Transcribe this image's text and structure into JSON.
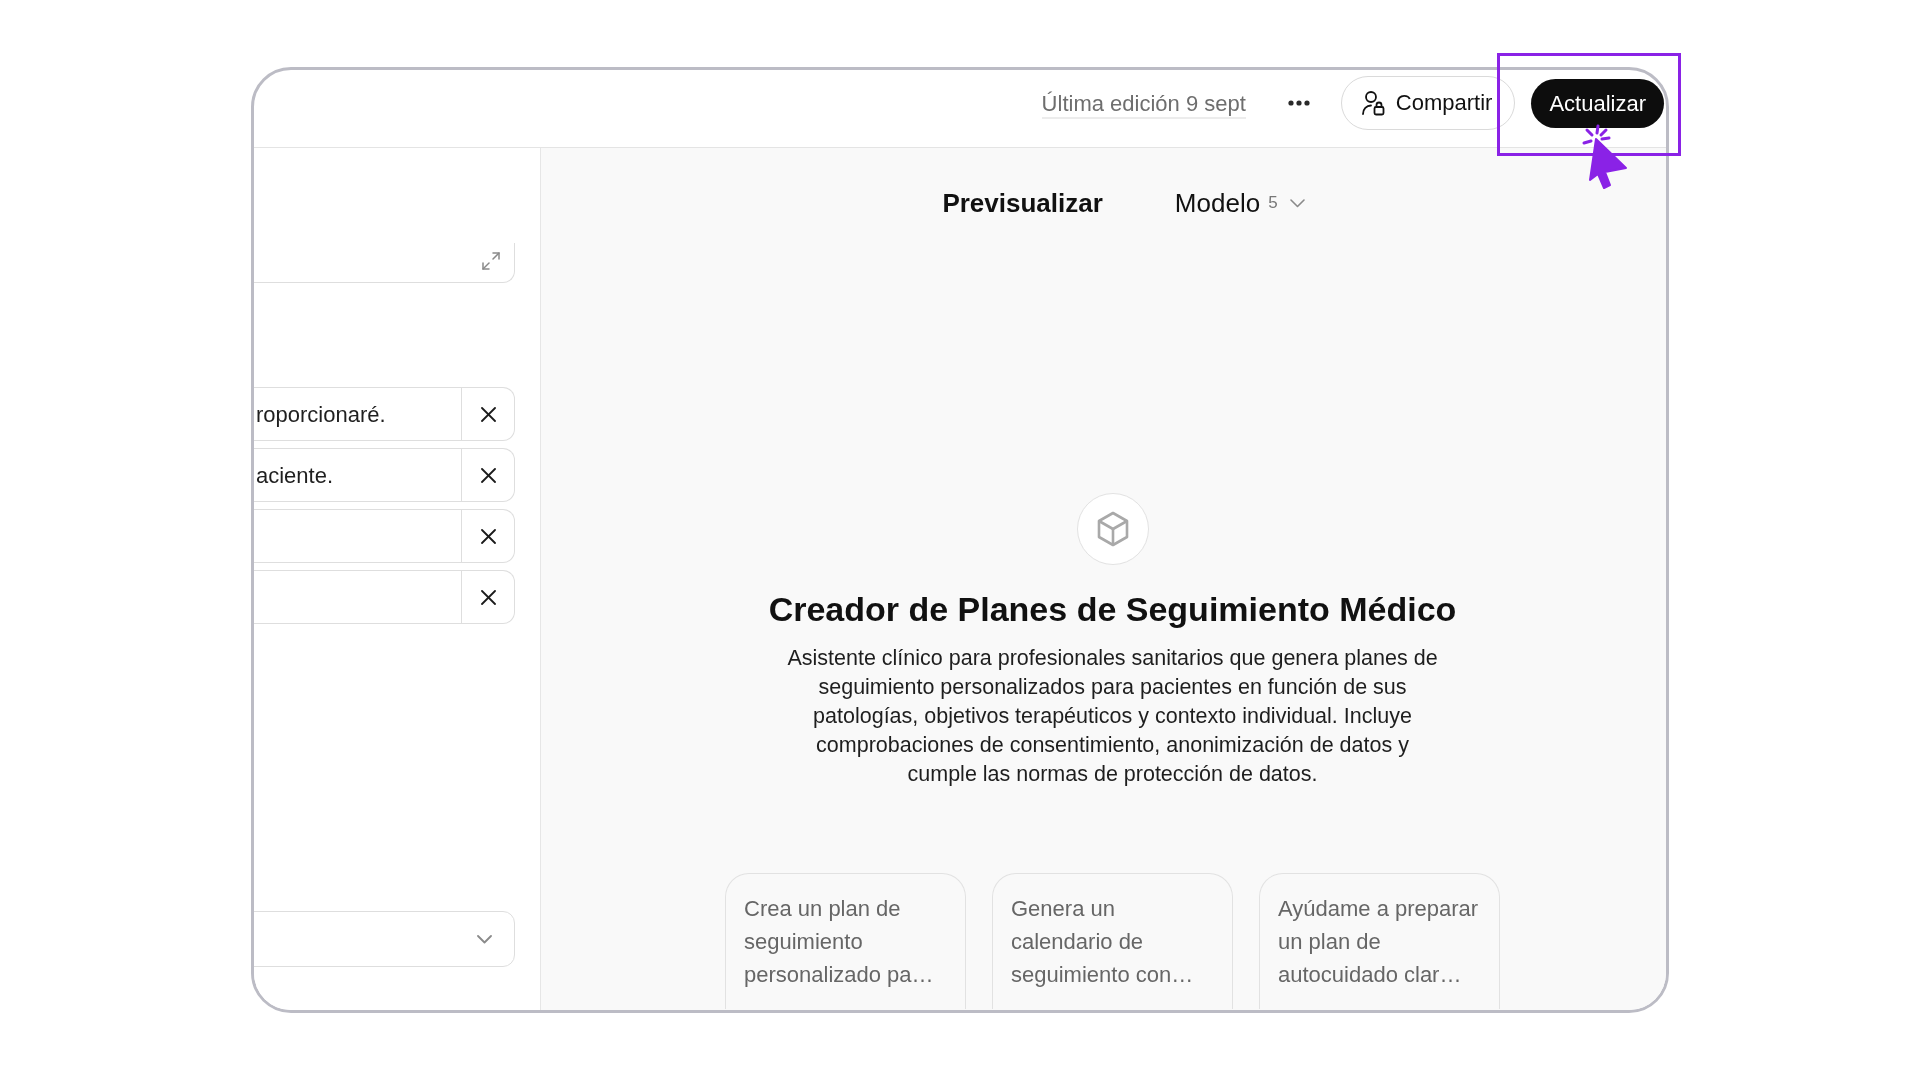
{
  "top_bar": {
    "last_edited": "Última edición 9 sept",
    "share_button": {
      "label": "Compartir"
    },
    "update_button": {
      "label": "Actualizar",
      "highlighted": true
    }
  },
  "editor": {
    "list_fields": [
      {
        "kind": "filled",
        "value": "roporcionaré."
      },
      {
        "kind": "filled",
        "value": "aciente."
      },
      {
        "kind": "blank"
      },
      {
        "kind": "blank"
      }
    ]
  },
  "preview": {
    "tabs": [
      {
        "label": "Previsualizar",
        "selected": true,
        "menu": false
      },
      {
        "label": "Modelo",
        "selected": false,
        "count": "5",
        "menu": true
      }
    ],
    "title": "Creador de Planes de Seguimiento Médico",
    "description": "Asistente clínico para profesionales sanitarios que genera planes de seguimiento personalizados para pacientes en función de sus patologías, objetivos terapéuticos y contexto individual. Incluye comprobaciones de consentimiento, anonimización de datos y cumple las normas de protección de datos.",
    "suggestions": [
      "Crea un plan de seguimiento personalizado pa…",
      "Genera un calendario de seguimiento con…",
      "Ayúdame a preparar un plan de autocuidado clar…"
    ]
  }
}
